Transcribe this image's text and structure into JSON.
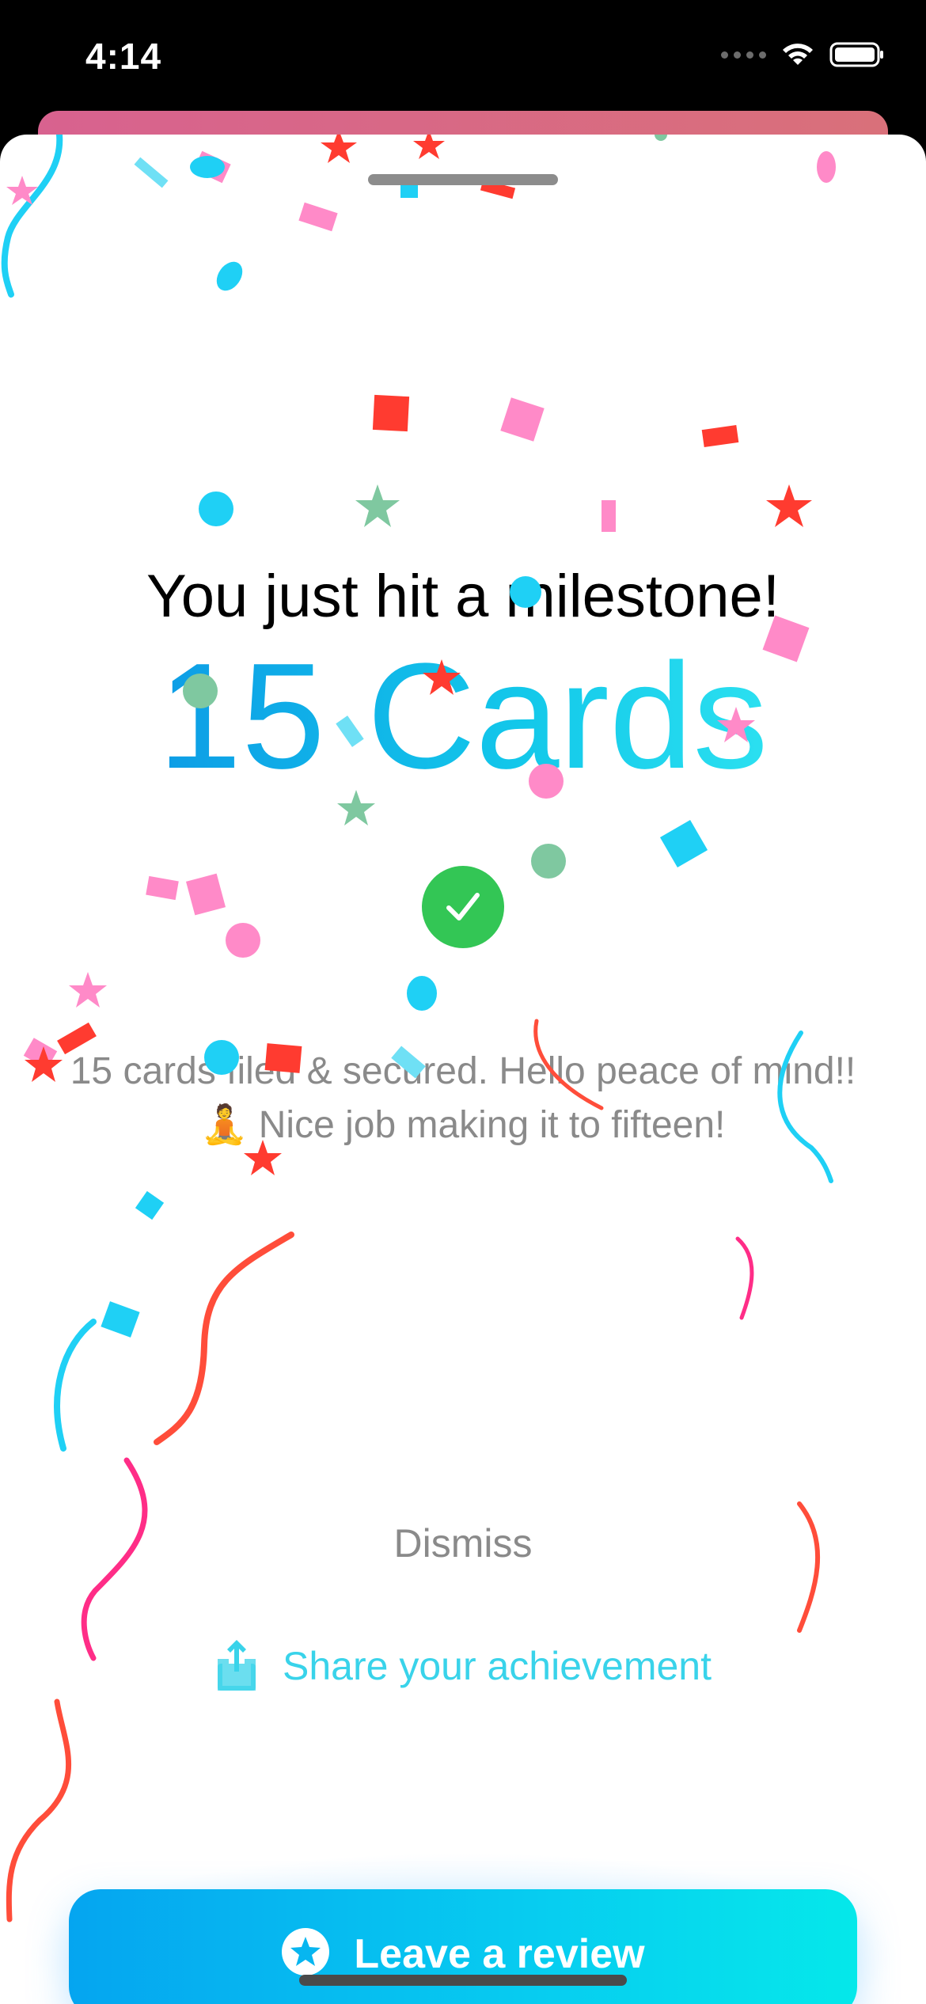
{
  "status_bar": {
    "time": "4:14",
    "icons": [
      "cellular-dots-icon",
      "wifi-icon",
      "battery-icon"
    ]
  },
  "milestone": {
    "headline": "You just hit a milestone!",
    "count_label": "15 Cards",
    "check_icon": "checkmark-circle-icon",
    "description_line1": "15 cards filed & secured. Hello peace of mind!!",
    "description_line2": "🧘 Nice job making it to fifteen!"
  },
  "actions": {
    "dismiss_label": "Dismiss",
    "share_label": "Share your achievement",
    "share_icon": "share-icon",
    "review_label": "Leave a review",
    "review_icon": "star-circle-icon"
  },
  "colors": {
    "accent_start": "#05a5f0",
    "accent_end": "#05e8ea",
    "success": "#33c655",
    "confetti": [
      "#ff8ac8",
      "#ff3b30",
      "#1fd0f5",
      "#7fc8a0",
      "#ff2d87",
      "#ff4d3a"
    ]
  }
}
